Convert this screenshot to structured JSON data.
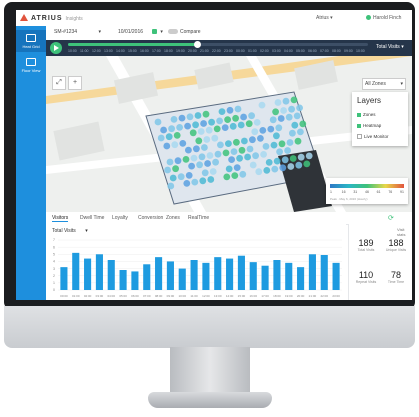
{
  "header": {
    "brand": "ATRIUS",
    "brand_sub": "Insights",
    "tenant": "Atrius",
    "user": "Harold Finch"
  },
  "sidebar": {
    "items": [
      {
        "label": "Heat Grid",
        "active": true
      },
      {
        "label": "Floor View",
        "active": false
      }
    ]
  },
  "filters": {
    "site": "SM-#1234",
    "date": "10/01/2016",
    "compare_label": "Compare"
  },
  "timeline": {
    "ticks": [
      "10:00",
      "11:00",
      "12:00",
      "13:00",
      "14:00",
      "15:00",
      "16:00",
      "17:00",
      "18:00",
      "19:00",
      "20:00",
      "21:00",
      "22:00",
      "23:00",
      "00:00",
      "01:00",
      "02:00",
      "03:00",
      "04:00",
      "05:00",
      "06:00",
      "07:00",
      "08:00",
      "09:00",
      "10:00"
    ],
    "progress": 0.43,
    "metric": "Total Visits"
  },
  "map": {
    "zones_select": "All Zones",
    "layers_title": "Layers",
    "layers": [
      {
        "label": "Zones",
        "checked": true
      },
      {
        "label": "Heatmap",
        "checked": true
      },
      {
        "label": "Live Monitor",
        "checked": false
      }
    ],
    "legend_ticks": [
      "1",
      "16",
      "31",
      "46",
      "61",
      "76",
      "91"
    ],
    "legend_note": "Peak · May 6, 2016 (Hourly)"
  },
  "tabs": [
    "Visitors",
    "Dwell Time",
    "Loyalty",
    "Conversion",
    "Zones",
    "RealTime"
  ],
  "chart": {
    "selector": "Total Visits",
    "chart_data": {
      "type": "bar",
      "categories": [
        "00:00",
        "01:00",
        "02:00",
        "03:00",
        "04:00",
        "05:00",
        "06:00",
        "07:00",
        "08:00",
        "09:00",
        "10:00",
        "11:00",
        "12:00",
        "13:00",
        "14:00",
        "15:00",
        "16:00",
        "17:00",
        "18:00",
        "19:00",
        "20:00",
        "21:00",
        "22:00",
        "23:00"
      ],
      "values": [
        3.2,
        5.2,
        4.4,
        5.0,
        4.2,
        2.8,
        2.6,
        3.6,
        4.6,
        4.0,
        3.0,
        4.2,
        3.8,
        4.6,
        4.4,
        4.8,
        3.9,
        3.4,
        4.2,
        3.8,
        3.2,
        5.0,
        4.9,
        3.8
      ],
      "ylim": [
        0,
        7
      ],
      "yticks": [
        "0",
        "1",
        "2",
        "3",
        "4",
        "5",
        "6",
        "7"
      ],
      "color": "#1e9be0"
    }
  },
  "stats": {
    "title": "Visit stats",
    "items": [
      {
        "value": "189",
        "label": "Total Visits"
      },
      {
        "value": "188",
        "label": "Unique Visits"
      },
      {
        "value": "110",
        "label": "Repeat Visits"
      },
      {
        "value": "78",
        "label": "Time Time"
      }
    ]
  }
}
